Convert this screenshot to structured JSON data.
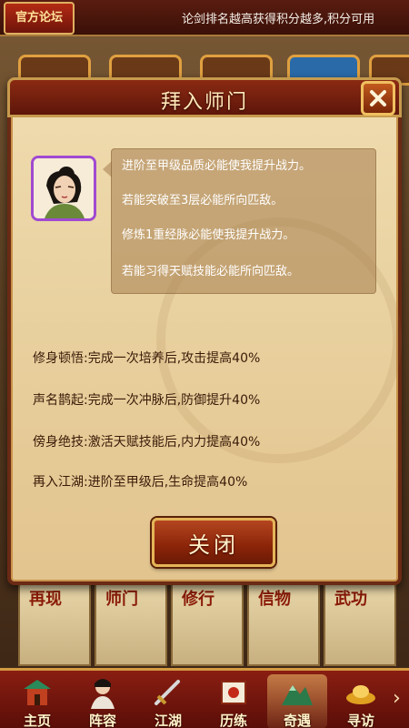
{
  "topbar": {
    "forum_badge": "官方论坛",
    "ticker_text": "论剑排名越高获得积分越多,积分可用"
  },
  "modal": {
    "title": "拜入师门",
    "close_icon": "close-icon",
    "dialog_lines": [
      "进阶至甲级品质必能使我提升战力。",
      "若能突破至3层必能所向匹敌。",
      "修炼1重经脉必能使我提升战力。",
      "若能习得天赋技能必能所向匹敌。"
    ],
    "bonuses": [
      {
        "name": "修身顿悟",
        "desc": "完成一次培养后,攻击提高40%"
      },
      {
        "name": "声名鹊起",
        "desc": "完成一次冲脉后,防御提升40%"
      },
      {
        "name": "傍身绝技",
        "desc": "激活天赋技能后,内力提高40%"
      },
      {
        "name": "再入江湖",
        "desc": "进阶至甲级后,生命提高40%"
      }
    ],
    "close_button": "关闭"
  },
  "scrolls": [
    "再现",
    "师门",
    "修行",
    "信物",
    "武功"
  ],
  "bottom_nav": {
    "items": [
      {
        "label": "主页",
        "icon": "palace-icon",
        "active": false
      },
      {
        "label": "阵容",
        "icon": "hero-portrait-icon",
        "active": false
      },
      {
        "label": "江湖",
        "icon": "sword-icon",
        "active": false
      },
      {
        "label": "历练",
        "icon": "scroll-icon",
        "active": false
      },
      {
        "label": "奇遇",
        "icon": "mountain-icon",
        "active": true
      },
      {
        "label": "寻访",
        "icon": "gold-ingot-icon",
        "active": false
      }
    ],
    "next_icon": "chevron-right-icon"
  },
  "colors": {
    "accent": "#c79b4e",
    "header_red": "#8a2a12",
    "parchment": "#f0dcb0"
  }
}
